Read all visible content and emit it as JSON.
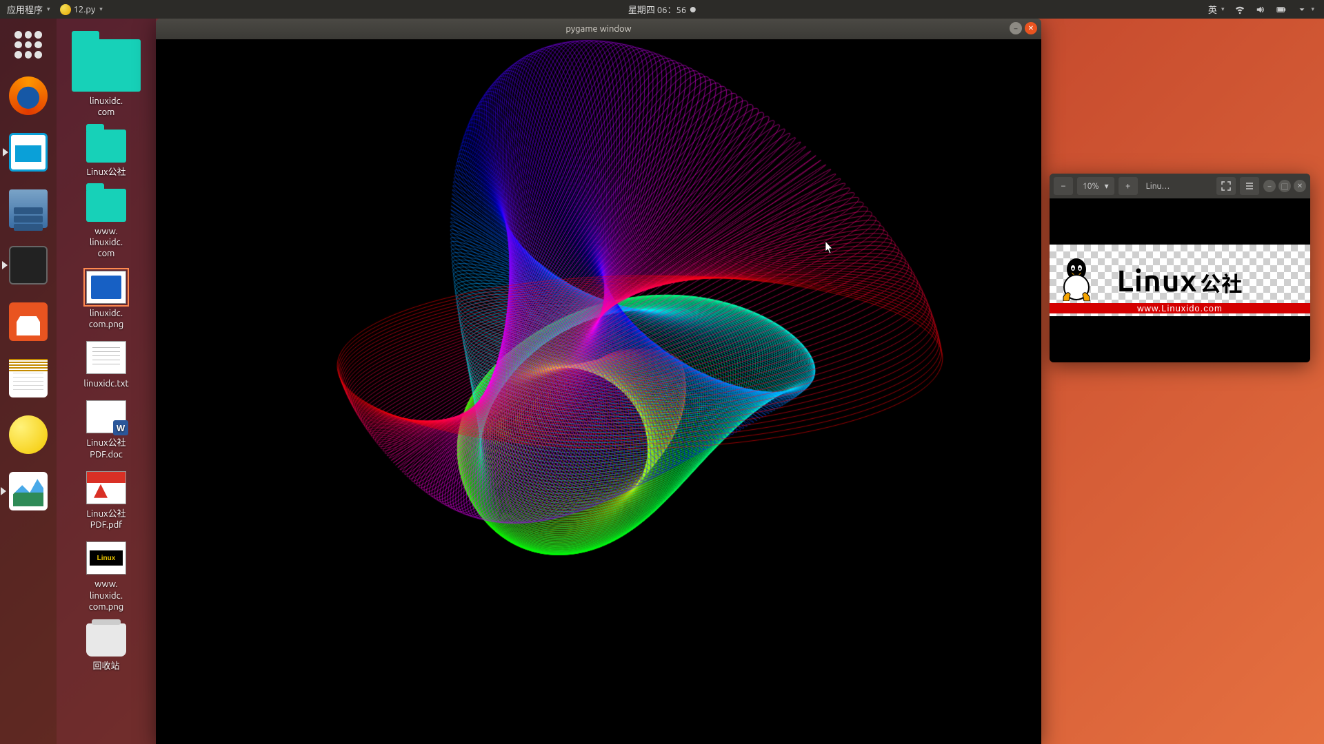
{
  "panel": {
    "apps_menu": "应用程序",
    "script_name": "12.py",
    "clock": "星期四 06：56",
    "ime": "英"
  },
  "desktop": {
    "items": [
      {
        "id": "folder-linuxidc-com",
        "kind": "folder large",
        "label": "linuxidc.\ncom"
      },
      {
        "id": "folder-linuxgs",
        "kind": "folder",
        "label": "Linux公社"
      },
      {
        "id": "folder-www-linuxidc",
        "kind": "folder",
        "label": "www.\nlinuxidc.\ncom"
      },
      {
        "id": "png-linuxidc",
        "kind": "pngfile",
        "label": "linuxidc.\ncom.png",
        "selected": true
      },
      {
        "id": "txt-linuxidc",
        "kind": "txtfile",
        "label": "linuxidc.txt"
      },
      {
        "id": "doc-linuxgs",
        "kind": "docfile",
        "label": "Linux公社\nPDF.doc"
      },
      {
        "id": "pdf-linuxgs",
        "kind": "pdffile",
        "label": "Linux公社\nPDF.pdf"
      },
      {
        "id": "png-www-linuxidc",
        "kind": "pngfile2",
        "label": "www.\nlinuxidc.\ncom.png"
      },
      {
        "id": "trash",
        "kind": "trash",
        "label": "回收站"
      }
    ]
  },
  "pygame": {
    "title": "pygame window"
  },
  "viewer": {
    "zoom": "10%",
    "title": "Linu…",
    "logo_text": "Linux",
    "logo_cn": "公社",
    "logo_url": "www.Linuxido.com"
  }
}
